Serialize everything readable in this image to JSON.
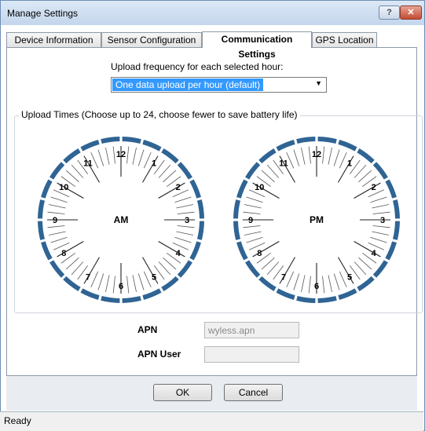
{
  "window": {
    "title": "Manage Settings",
    "help_label": "?",
    "close_label": "✕"
  },
  "tabs": [
    {
      "label": "Device Information"
    },
    {
      "label": "Sensor Configuration"
    },
    {
      "label": "Communication Settings",
      "active": true
    },
    {
      "label": "GPS Location"
    }
  ],
  "upload": {
    "label": "Upload frequency for each selected hour:",
    "selected": "One data upload per hour (default)"
  },
  "upload_times": {
    "legend": "Upload Times (Choose up to 24, choose fewer to save battery life)",
    "clocks": [
      {
        "period": "AM",
        "numbers": [
          "12",
          "1",
          "2",
          "3",
          "4",
          "5",
          "6",
          "7",
          "8",
          "9",
          "10",
          "11"
        ]
      },
      {
        "period": "PM",
        "numbers": [
          "12",
          "1",
          "2",
          "3",
          "4",
          "5",
          "6",
          "7",
          "8",
          "9",
          "10",
          "11"
        ]
      }
    ]
  },
  "apn": {
    "label": "APN",
    "value": "wyless.apn"
  },
  "apn_user": {
    "label": "APN User",
    "value": ""
  },
  "buttons": {
    "ok": "OK",
    "cancel": "Cancel"
  },
  "status": "Ready",
  "colors": {
    "ring": "#2f6494",
    "selection": "#3399ff"
  }
}
